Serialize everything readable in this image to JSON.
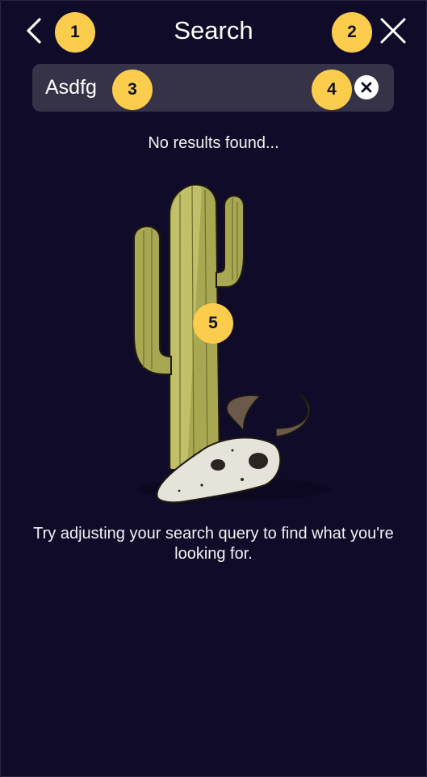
{
  "header": {
    "title": "Search",
    "back_icon": "chevron-left-icon",
    "close_icon": "close-icon"
  },
  "search": {
    "value": "Asdfg",
    "placeholder": "",
    "clear_icon": "clear-circle-icon"
  },
  "empty_state": {
    "message": "No results found...",
    "illustration": "cactus-and-skull-illustration",
    "hint": "Try adjusting your search query to find what you're looking for."
  },
  "markers": [
    "1",
    "2",
    "3",
    "4",
    "5"
  ],
  "colors": {
    "background": "#110b2a",
    "search_box": "#363348",
    "marker": "#fccd4d",
    "cactus": "#a9a852",
    "skull": "#e6e4da",
    "horn": "#6b5a4a"
  }
}
